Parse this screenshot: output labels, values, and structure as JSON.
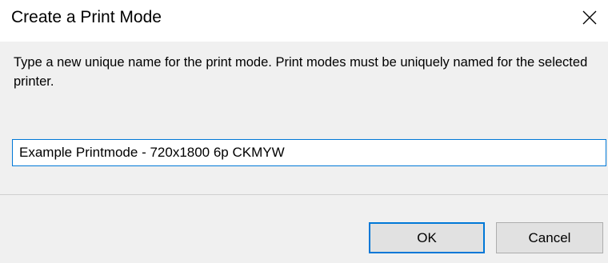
{
  "dialog": {
    "title": "Create a Print Mode",
    "close_icon": "close-icon",
    "message": "Type a new unique name for the print mode. Print modes must be uniquely named for the selected printer.",
    "name_input": {
      "value": "Example Printmode - 720x1800 6p CKMYW"
    },
    "buttons": {
      "ok_label": "OK",
      "cancel_label": "Cancel"
    }
  },
  "colors": {
    "accent": "#0078d7",
    "background": "#f0f0f0",
    "titlebar": "#ffffff",
    "button_face": "#e1e1e1"
  }
}
